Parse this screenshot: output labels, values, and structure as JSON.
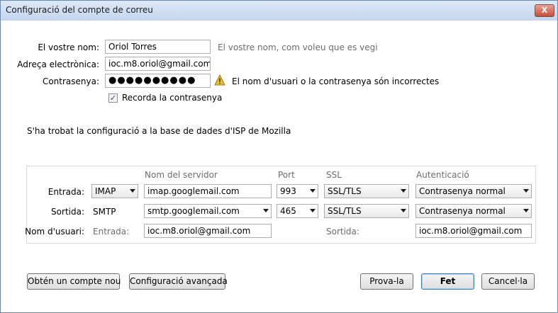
{
  "window": {
    "title": "Configuració del compte de correu",
    "close_label": "X"
  },
  "identity": {
    "name_label": "El vostre nom:",
    "name_value": "Oriol Torres",
    "name_hint": "El vostre nom, com voleu que es vegi",
    "email_label": "Adreça electrònica:",
    "email_value": "ioc.m8.oriol@gmail.com",
    "password_label": "Contrasenya:",
    "password_value": "●●●●●●●●●●",
    "password_warning": "El nom d'usuari o la contrasenya són incorrectes",
    "remember_label": "Recorda la contrasenya",
    "remember_checked": true
  },
  "status_message": "S'ha trobat la configuració a la base de dades d'ISP de Mozilla",
  "server_table": {
    "headers": {
      "server": "Nom del servidor",
      "port": "Port",
      "ssl": "SSL",
      "auth": "Autenticació"
    },
    "incoming": {
      "label": "Entrada:",
      "protocol": "IMAP",
      "server": "imap.googlemail.com",
      "port": "993",
      "ssl": "SSL/TLS",
      "auth": "Contrasenya normal"
    },
    "outgoing": {
      "label": "Sortida:",
      "protocol": "SMTP",
      "server": "smtp.googlemail.com",
      "port": "465",
      "ssl": "SSL/TLS",
      "auth": "Contrasenya normal"
    },
    "username": {
      "label": "Nom d'usuari:",
      "incoming_label": "Entrada:",
      "incoming_value": "ioc.m8.oriol@gmail.com",
      "outgoing_label": "Sortida:",
      "outgoing_value": "ioc.m8.oriol@gmail.com"
    }
  },
  "buttons": {
    "new_account": "Obtén un compte nou",
    "advanced": "Configuració avançada",
    "retest": "Prova-la",
    "done": "Fet",
    "cancel": "Cancel·la"
  },
  "colors": {
    "warning": "#e8c22c",
    "title_gradient_top": "#dce8f7",
    "title_gradient_bottom": "#c4d6ee"
  }
}
